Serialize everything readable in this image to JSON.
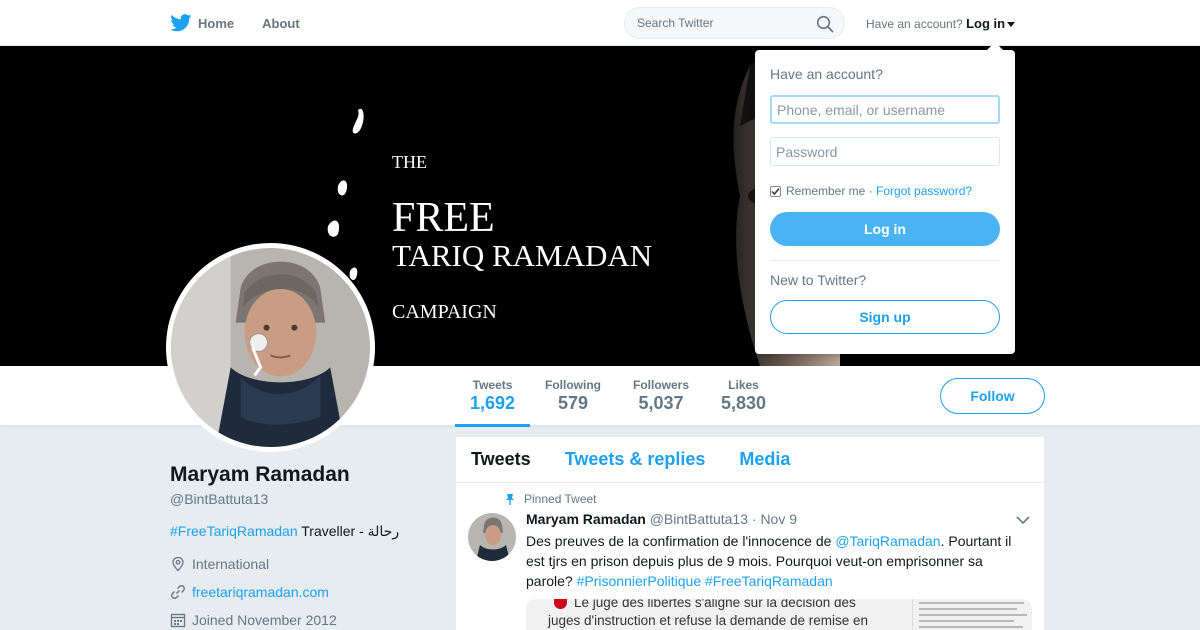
{
  "nav": {
    "home": "Home",
    "about": "About",
    "search_placeholder": "Search Twitter",
    "have_account": "Have an account?",
    "login": "Log in"
  },
  "banner": {
    "line_the": "THE",
    "line_free": "FREE",
    "line_name": "TARIQ RAMADAN",
    "line_campaign": "CAMPAIGN"
  },
  "stats": [
    {
      "label": "Tweets",
      "value": "1,692"
    },
    {
      "label": "Following",
      "value": "579"
    },
    {
      "label": "Followers",
      "value": "5,037"
    },
    {
      "label": "Likes",
      "value": "5,830"
    }
  ],
  "follow_label": "Follow",
  "profile": {
    "name": "Maryam Ramadan",
    "handle": "@BintBattuta13",
    "bio_hashtag": "#FreeTariqRamadan",
    "bio_rest": " Traveller - رحالة",
    "location": "International",
    "website": "freetariqramadan.com",
    "joined": "Joined November 2012"
  },
  "timeline": {
    "tabs": [
      "Tweets",
      "Tweets & replies",
      "Media"
    ],
    "pinned_label": "Pinned Tweet",
    "tweet": {
      "name": "Maryam Ramadan",
      "handle": "@BintBattuta13",
      "date": "· Nov 9",
      "text_1": "Des preuves de la confirmation de l'innocence de ",
      "mention": "@TariqRamadan",
      "text_2": ". Pourtant il est tjrs en prison depuis plus de 9 mois. Pourquoi veut-on emprisonner sa parole? ",
      "hashtag_1": "#PrisonnierPolitique",
      "hashtag_2": "#FreeTariqRamadan",
      "media_line_1": "Le juge des libertés s'aligne sur la décision des",
      "media_line_2": "juges d'instruction et refuse la demande de remise en"
    }
  },
  "login_dropdown": {
    "title": "Have an account?",
    "username_placeholder": "Phone, email, or username",
    "password_placeholder": "Password",
    "remember": "Remember me",
    "separator": " · ",
    "forgot": "Forgot password?",
    "login_button": "Log in",
    "new_to": "New to Twitter?",
    "signup_button": "Sign up"
  },
  "colors": {
    "accent": "#1da1f2",
    "login_button": "#4ab3f4",
    "page_bg": "#e6ecf0"
  }
}
